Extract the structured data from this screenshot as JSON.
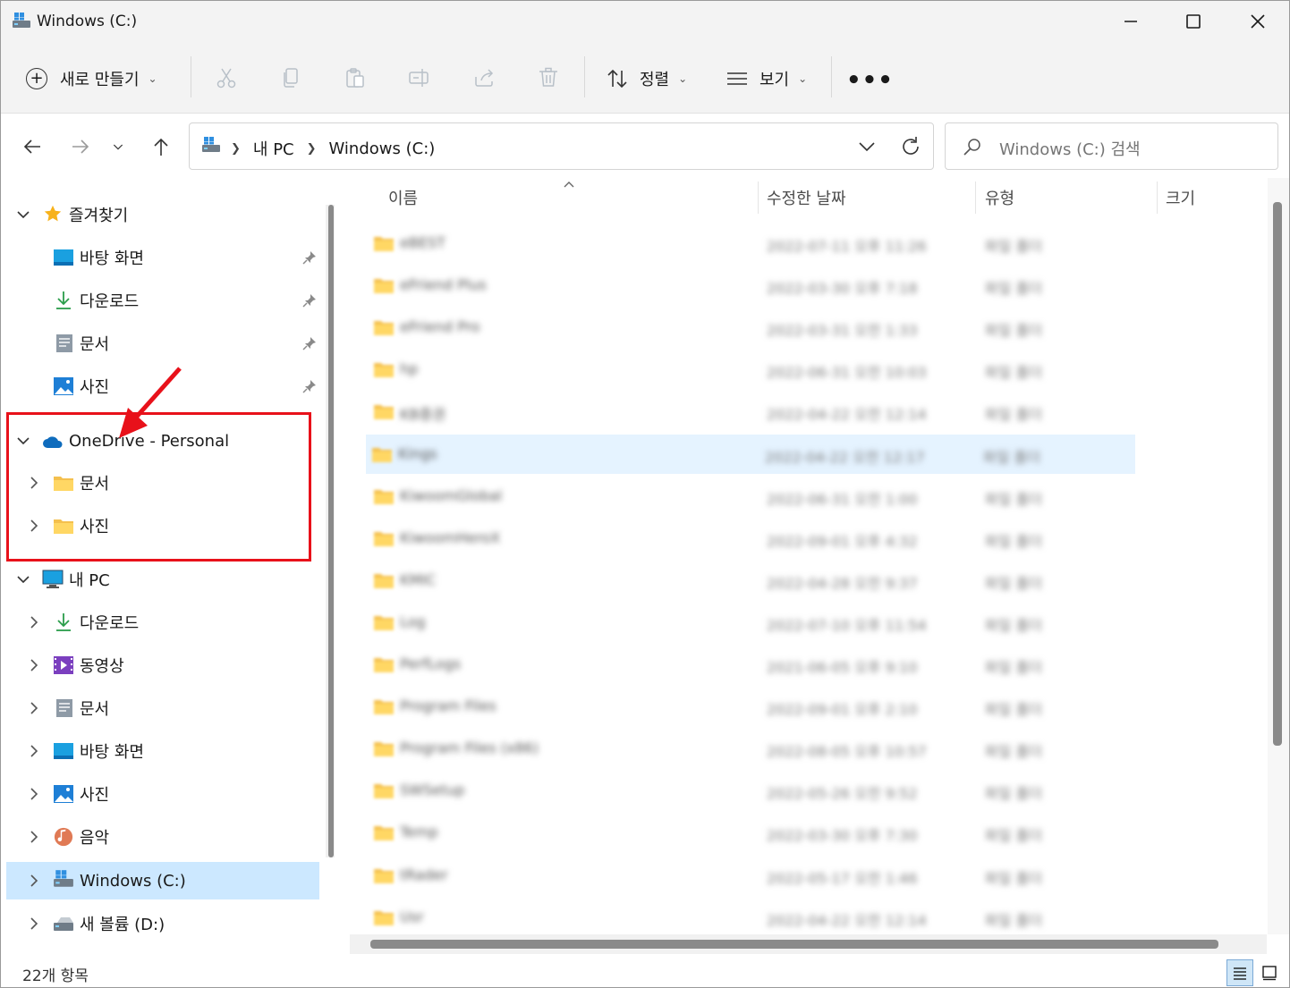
{
  "window": {
    "title": "Windows (C:)"
  },
  "toolbar": {
    "new_label": "새로 만들기",
    "sort_label": "정렬",
    "view_label": "보기",
    "more_label": "•••",
    "icons": [
      "cut-icon",
      "copy-icon",
      "paste-icon",
      "rename-icon",
      "share-icon",
      "delete-icon"
    ]
  },
  "address": {
    "crumbs": [
      "내 PC",
      "Windows (C:)"
    ],
    "search_placeholder": "Windows (C:) 검색"
  },
  "nav": {
    "favorites": {
      "label": "즐겨찾기",
      "items": [
        {
          "label": "바탕 화면",
          "icon": "desktop-icon",
          "pinned": true
        },
        {
          "label": "다운로드",
          "icon": "download-icon",
          "pinned": true
        },
        {
          "label": "문서",
          "icon": "document-icon",
          "pinned": true
        },
        {
          "label": "사진",
          "icon": "pictures-icon",
          "pinned": true
        }
      ]
    },
    "onedrive": {
      "label": "OneDrive - Personal",
      "items": [
        {
          "label": "문서",
          "icon": "folder-icon"
        },
        {
          "label": "사진",
          "icon": "folder-icon"
        }
      ]
    },
    "thispc": {
      "label": "내 PC",
      "items": [
        {
          "label": "다운로드",
          "icon": "download-icon"
        },
        {
          "label": "동영상",
          "icon": "video-icon"
        },
        {
          "label": "문서",
          "icon": "document-icon"
        },
        {
          "label": "바탕 화면",
          "icon": "desktop-icon"
        },
        {
          "label": "사진",
          "icon": "pictures-icon"
        },
        {
          "label": "음악",
          "icon": "music-icon"
        },
        {
          "label": "Windows (C:)",
          "icon": "drive-c-icon",
          "selected": true
        },
        {
          "label": "새 볼륨 (D:)",
          "icon": "drive-d-icon"
        }
      ]
    }
  },
  "columns": {
    "name": "이름",
    "date": "수정한 날짜",
    "type": "유형",
    "size": "크기"
  },
  "files": [
    {
      "name": "eBEST",
      "date": "2022-07-11 오후 11:26",
      "type": "파일 폴더"
    },
    {
      "name": "eFriend Plus",
      "date": "2022-03-30 오후 7:18",
      "type": "파일 폴더"
    },
    {
      "name": "eFriend Pro",
      "date": "2022-03-31 오전 1:33",
      "type": "파일 폴더"
    },
    {
      "name": "hp",
      "date": "2022-06-31 오전 10:03",
      "type": "파일 폴더"
    },
    {
      "name": "KB증권",
      "date": "2022-04-22 오전 12:14",
      "type": "파일 폴더"
    },
    {
      "name": "Kings",
      "date": "2022-04-22 오전 12:17",
      "type": "파일 폴더",
      "hover": true
    },
    {
      "name": "KiwoomGlobal",
      "date": "2022-06-31 오전 1:00",
      "type": "파일 폴더"
    },
    {
      "name": "KiwoomHeroX",
      "date": "2022-09-01 오후 4:32",
      "type": "파일 폴더"
    },
    {
      "name": "KMIC",
      "date": "2022-04-28 오전 9:37",
      "type": "파일 폴더"
    },
    {
      "name": "Log",
      "date": "2022-07-10 오후 11:54",
      "type": "파일 폴더"
    },
    {
      "name": "PerfLogs",
      "date": "2021-06-05 오후 9:10",
      "type": "파일 폴더"
    },
    {
      "name": "Program Files",
      "date": "2022-09-01 오후 2:10",
      "type": "파일 폴더"
    },
    {
      "name": "Program Files (x86)",
      "date": "2022-08-05 오후 10:57",
      "type": "파일 폴더"
    },
    {
      "name": "SWSetup",
      "date": "2022-05-26 오전 9:52",
      "type": "파일 폴더"
    },
    {
      "name": "Temp",
      "date": "2022-03-30 오후 7:30",
      "type": "파일 폴더"
    },
    {
      "name": "tRader",
      "date": "2022-05-17 오전 1:46",
      "type": "파일 폴더"
    },
    {
      "name": "Usr",
      "date": "2022-04-22 오전 12:14",
      "type": "파일 폴더"
    }
  ],
  "status": {
    "count": "22개 항목"
  },
  "colors": {
    "selected_bg": "#cce8ff",
    "hover_bg": "#e5f3ff",
    "annotation": "#e8111a"
  }
}
